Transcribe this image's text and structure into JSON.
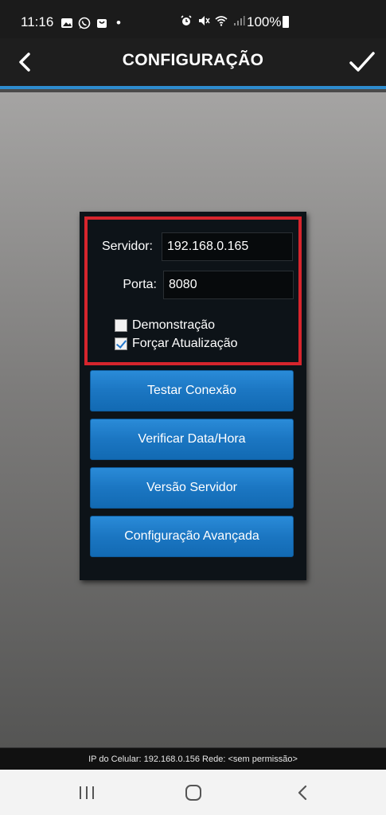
{
  "status_bar": {
    "time": "11:16",
    "dot": "•",
    "battery_percent": "100%",
    "left_icons": [
      "gallery-icon",
      "whatsapp-icon",
      "shopping-bag-icon"
    ],
    "right_icons": [
      "alarm-icon",
      "mute-icon",
      "wifi-icon",
      "signal-icon",
      "battery-icon"
    ]
  },
  "header": {
    "title": "CONFIGURAÇÃO",
    "back_icon": "chevron-left-icon",
    "confirm_icon": "checkmark-icon",
    "accent_color": "#2e8ccf"
  },
  "form": {
    "server_label": "Servidor:",
    "server_value": "192.168.0.165",
    "port_label": "Porta:",
    "port_value": "8080",
    "demo_label": "Demonstração",
    "demo_checked": false,
    "force_label": "Forçar Atualização",
    "force_checked": true,
    "highlight_color": "#d6252d"
  },
  "buttons": {
    "test": "Testar Conexão",
    "verify": "Verificar Data/Hora",
    "version": "Versão Servidor",
    "advanced": "Configuração Avançada"
  },
  "info_bar": {
    "text": "IP do Celular: 192.168.0.156  Rede: <sem permissão>"
  },
  "nav": {
    "recent_icon": "recent-apps-icon",
    "home_icon": "home-icon",
    "back_icon": "back-icon"
  }
}
